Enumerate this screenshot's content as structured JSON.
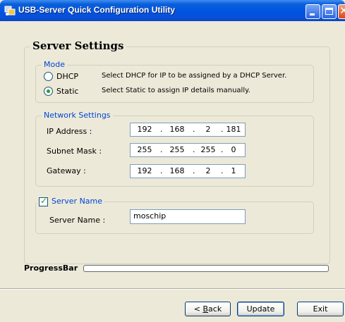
{
  "window": {
    "title": "USB-Server Quick Configuration Utility"
  },
  "server_settings": {
    "title": "Server Settings"
  },
  "mode": {
    "legend": "Mode",
    "options": [
      {
        "label": "DHCP",
        "description": "Select DHCP for IP to be assigned by a DHCP Server.",
        "selected": false
      },
      {
        "label": "Static",
        "description": "Select Static to assign IP details manually.",
        "selected": true
      }
    ]
  },
  "network": {
    "legend": "Network Settings",
    "ip_label": "IP Address :",
    "ip": [
      "192",
      "168",
      "2",
      "181"
    ],
    "subnet_label": "Subnet Mask :",
    "subnet": [
      "255",
      "255",
      "255",
      "0"
    ],
    "gateway_label": "Gateway :",
    "gateway": [
      "192",
      "168",
      "2",
      "1"
    ]
  },
  "server_name": {
    "legend": "Server Name",
    "checked": true,
    "label": "Server Name :",
    "value": "moschip"
  },
  "progress": {
    "label": "ProgressBar",
    "value": 0
  },
  "buttons": {
    "back_prefix": "< ",
    "back_key": "B",
    "back_rest": "ack",
    "update": "Update",
    "exit": "Exit"
  },
  "colors": {
    "titlebar": "#0054e3",
    "legend_text": "#0046d5",
    "dialog_bg": "#ece9d8"
  }
}
